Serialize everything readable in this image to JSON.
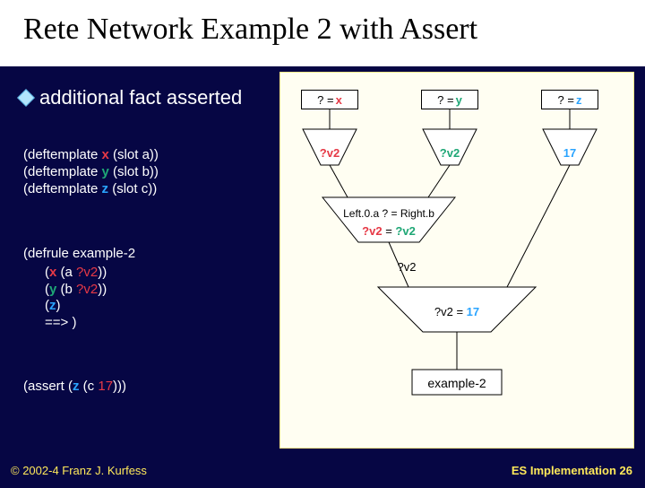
{
  "title": "Rete Network Example 2 with Assert",
  "bullet": "additional fact asserted",
  "code": {
    "templates": {
      "x_pre": "(deftemplate ",
      "x_name": "x",
      "x_post": " (slot a))",
      "y_pre": "(deftemplate ",
      "y_name": "y",
      "y_post": " (slot b))",
      "z_pre": "(deftemplate ",
      "z_name": "z",
      "z_post": " (slot c))"
    },
    "rule": {
      "head": "(defrule example-2",
      "l1_pre": "(",
      "l1_name": "x",
      "l1_mid": " (a ",
      "l1_var": "?v2",
      "l1_post": "))",
      "l2_pre": "(",
      "l2_name": "y",
      "l2_mid": " (b ",
      "l2_var": "?v2",
      "l2_post": "))",
      "l3_pre": "(",
      "l3_name": "z",
      "l3_post": ")",
      "arrow": "==> )"
    },
    "assert": {
      "pre": "(assert (",
      "name": "z",
      "mid": " (c ",
      "val": "17",
      "post": ")))"
    }
  },
  "diagram": {
    "root_x": {
      "q": "? = ",
      "n": "x"
    },
    "root_y": {
      "q": "? = ",
      "n": "y"
    },
    "root_z": {
      "q": "? = ",
      "n": "z"
    },
    "alpha_x": "?v2",
    "alpha_y": "?v2",
    "alpha_z": "17",
    "join1_test": "Left.0.a ? = Right.b",
    "join1_eq_l": "?v2",
    "join1_eq_mid": " = ",
    "join1_eq_r": "?v2",
    "join2_out": "?v2",
    "join3_l": "?v2",
    "join3_mid": " = ",
    "join3_r": "17",
    "terminal": "example-2"
  },
  "footer": {
    "left": "© 2002-4 Franz J. Kurfess",
    "right_label": "ES Implementation",
    "right_num": "26"
  }
}
